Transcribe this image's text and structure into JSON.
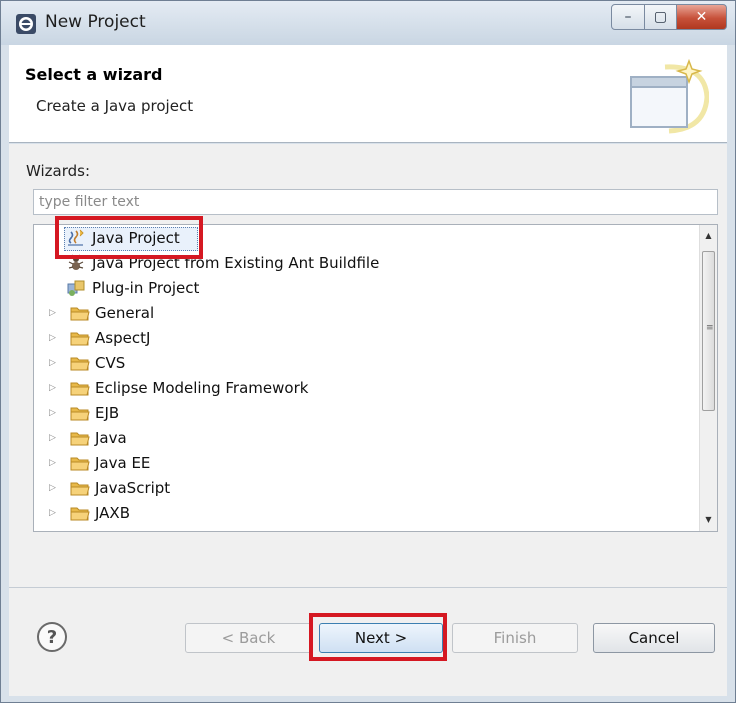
{
  "window": {
    "title": "New Project"
  },
  "header": {
    "title": "Select a wizard",
    "description": "Create a Java project"
  },
  "wizards": {
    "label": "Wizards:",
    "filter_placeholder": "type filter text",
    "items": [
      {
        "label": "Java Project",
        "icon": "java-project-icon",
        "expandable": false,
        "selected": true
      },
      {
        "label": "Java Project from Existing Ant Buildfile",
        "icon": "ant-icon",
        "expandable": false,
        "selected": false
      },
      {
        "label": "Plug-in Project",
        "icon": "plugin-icon",
        "expandable": false,
        "selected": false
      },
      {
        "label": "General",
        "icon": "folder-icon",
        "expandable": true
      },
      {
        "label": "AspectJ",
        "icon": "folder-icon",
        "expandable": true
      },
      {
        "label": "CVS",
        "icon": "folder-icon",
        "expandable": true
      },
      {
        "label": "Eclipse Modeling Framework",
        "icon": "folder-icon",
        "expandable": true
      },
      {
        "label": "EJB",
        "icon": "folder-icon",
        "expandable": true
      },
      {
        "label": "Java",
        "icon": "folder-icon",
        "expandable": true
      },
      {
        "label": "Java EE",
        "icon": "folder-icon",
        "expandable": true
      },
      {
        "label": "JavaScript",
        "icon": "folder-icon",
        "expandable": true
      },
      {
        "label": "JAXB",
        "icon": "folder-icon",
        "expandable": true
      }
    ]
  },
  "buttons": {
    "help": "?",
    "back": "< Back",
    "next": "Next >",
    "finish": "Finish",
    "cancel": "Cancel"
  },
  "colors": {
    "highlight": "#d51822",
    "folder": "#e8b94a",
    "window_frame": "#d8e1ea"
  }
}
